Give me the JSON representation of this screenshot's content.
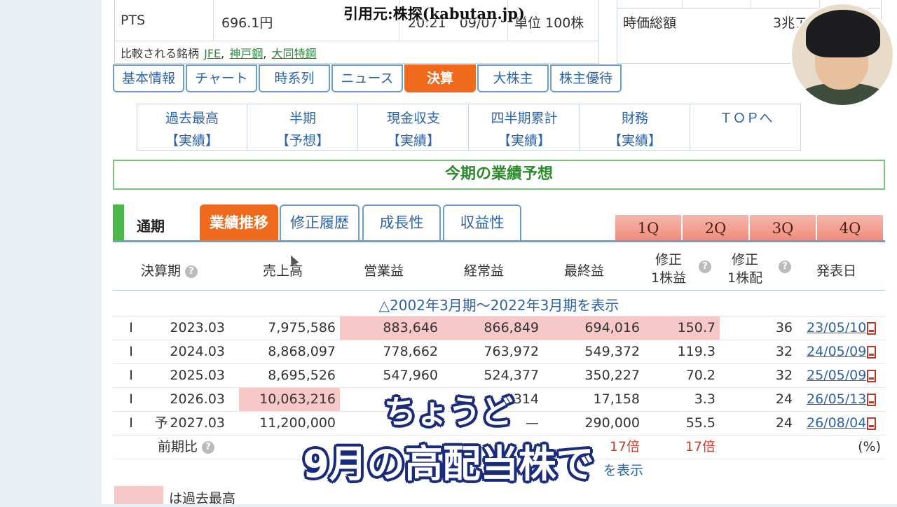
{
  "credit": "引用元:株探(kabutan.jp)",
  "quote": {
    "pts_label": "PTS",
    "pts_value": "696.1円",
    "pts_time": "20:21　09/07",
    "unit": "単位 100株",
    "compare_label": "比較される銘柄",
    "compare": [
      "JFE",
      "神戸鋼",
      "大同特鋼"
    ],
    "market_cap_label": "時価総額",
    "market_cap_value": "3兆ア"
  },
  "tabs": [
    "基本情報",
    "チャート",
    "時系列",
    "ニュース",
    "決算",
    "大株主",
    "株主優待"
  ],
  "active_tab": "決算",
  "subnav": [
    {
      "l1": "過去最高",
      "l2": "【実績】"
    },
    {
      "l1": "半期",
      "l2": "【予想】"
    },
    {
      "l1": "現金収支",
      "l2": "【実績】"
    },
    {
      "l1": "四半期累計",
      "l2": "【実績】"
    },
    {
      "l1": "財務",
      "l2": "【実績】"
    },
    {
      "l1": "ＴＯＰへ",
      "l2": ""
    }
  ],
  "heading": "今期の業績予想",
  "section": {
    "label": "通期",
    "tabs": [
      "業績推移",
      "修正履歴",
      "成長性",
      "収益性"
    ],
    "quarters": [
      "1Q",
      "2Q",
      "3Q",
      "4Q"
    ]
  },
  "table": {
    "headers": [
      "決算期",
      "売上高",
      "営業益",
      "経常益",
      "最終益",
      "修正",
      "1株益",
      "修正",
      "1株配",
      "発表日"
    ],
    "show_link": "△2002年3月期～2022年3月期を表示",
    "rows": [
      {
        "kind": "I",
        "forecast": "",
        "period": "2023.03",
        "sales": "7,975,586",
        "op": "883,646",
        "ord": "866,849",
        "net": "694,016",
        "eps": "150.7",
        "div": "36",
        "date": "23/05/10"
      },
      {
        "kind": "I",
        "forecast": "",
        "period": "2024.03",
        "sales": "8,868,097",
        "op": "778,662",
        "ord": "763,972",
        "net": "549,372",
        "eps": "119.3",
        "div": "32",
        "date": "24/05/09"
      },
      {
        "kind": "I",
        "forecast": "",
        "period": "2025.03",
        "sales": "8,695,526",
        "op": "547,960",
        "ord": "524,377",
        "net": "350,227",
        "eps": "70.2",
        "div": "32",
        "date": "25/05/09"
      },
      {
        "kind": "I",
        "forecast": "",
        "period": "2026.03",
        "sales": "10,063,216",
        "op": "",
        "ord": "314",
        "net": "17,158",
        "eps": "3.3",
        "div": "24",
        "date": "26/05/13"
      },
      {
        "kind": "I",
        "forecast": "予",
        "period": "2027.03",
        "sales": "11,200,000",
        "op": "",
        "ord": "—",
        "net": "290,000",
        "eps": "55.5",
        "div": "24",
        "date": "26/08/04"
      }
    ],
    "prev_ratio_label": "前期比",
    "prev_ratio_net": "17倍",
    "prev_ratio_eps": "17倍",
    "percent": "(%)",
    "show_bottom": "を表示"
  },
  "legend": "は過去最高",
  "subtitle": {
    "line1": "ちょうど",
    "line2": "9月の高配当株で"
  },
  "colors": {
    "accent": "#f06a1e",
    "link": "#2d63a8",
    "record_high": "#f7c8c8",
    "green": "#4db84a"
  }
}
